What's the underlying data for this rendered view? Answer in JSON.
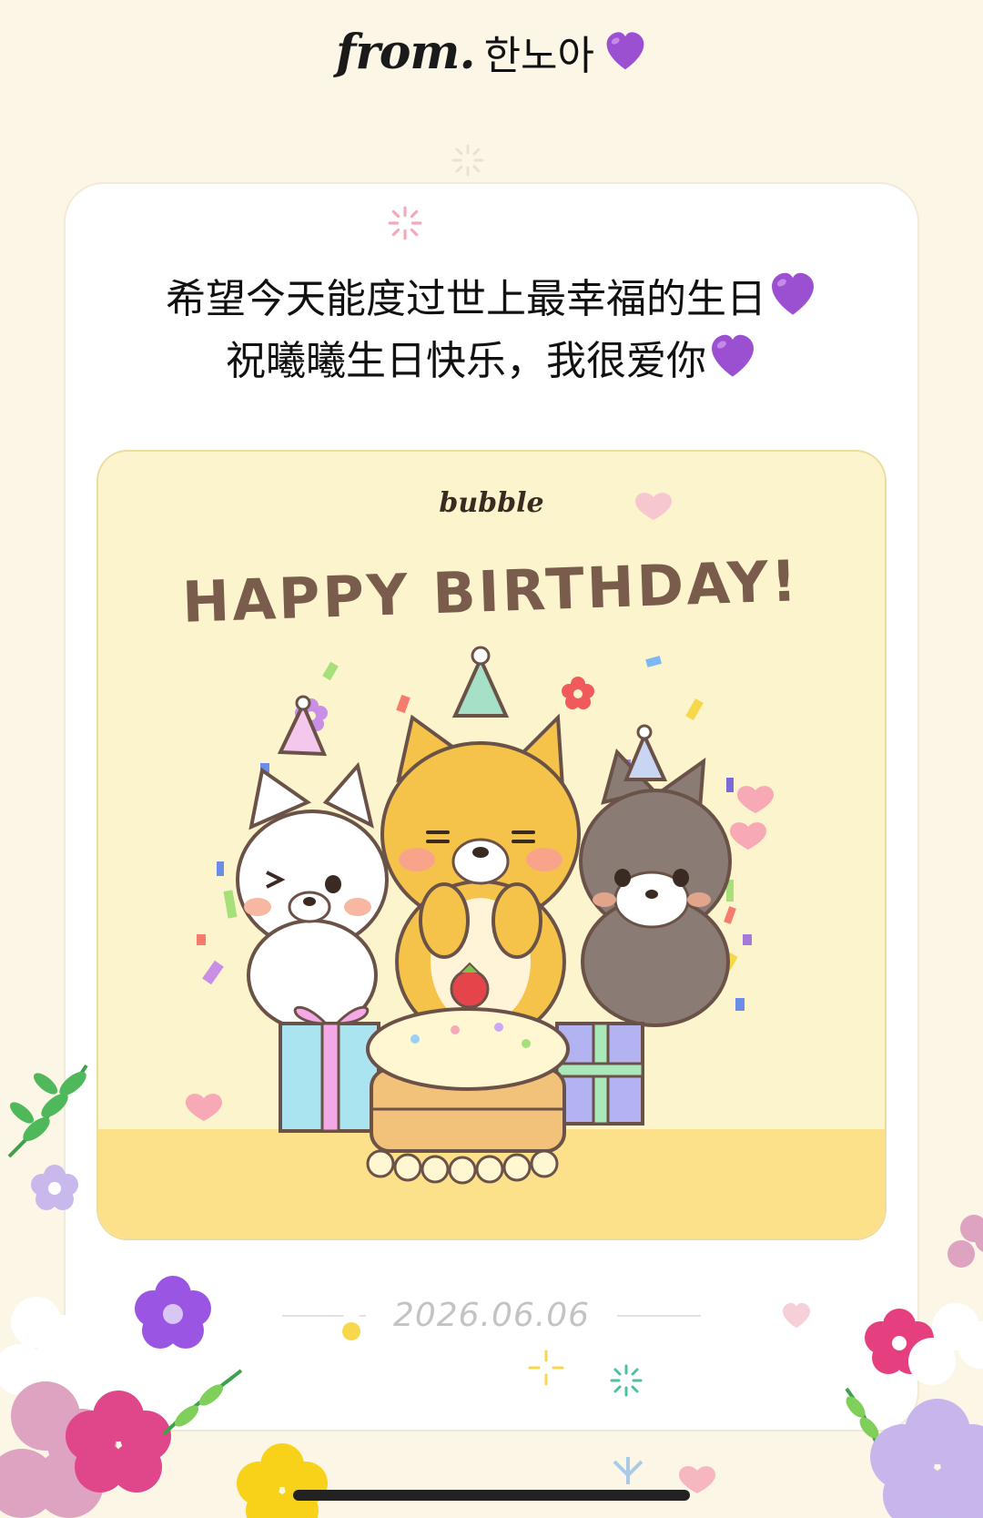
{
  "header": {
    "from_label": "from.",
    "sender": "한노아",
    "heart": "purple-heart"
  },
  "message": {
    "lines": [
      "希望今天能度过世上最幸福的生日",
      "祝曦曦生日快乐，我很爱你"
    ],
    "line_heart": "purple-heart"
  },
  "card_image": {
    "brand": "bubble",
    "headline": "HAPPY BIRTHDAY!",
    "scene": "three-shiba-dogs-with-cake-and-gifts"
  },
  "footer": {
    "date": "2026.06.06"
  },
  "colors": {
    "background": "#fcf6e6",
    "card": "#ffffff",
    "image_bg": "#fbf4cc",
    "headline": "#7a5c4c",
    "heart": "#9b4fd1",
    "date": "#c3c3c3"
  }
}
